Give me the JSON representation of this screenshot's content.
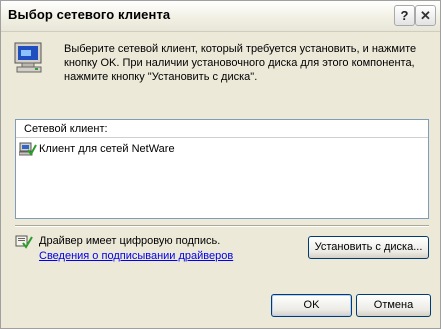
{
  "window": {
    "title": "Выбор сетевого клиента",
    "help_glyph": "?",
    "close_glyph": "✕"
  },
  "instructions": "Выберите сетевой клиент, который требуется установить, и нажмите кнопку OK. При наличии установочного диска для этого компонента, нажмите кнопку \"Установить с диска\".",
  "list": {
    "header": "Сетевой клиент:",
    "items": [
      {
        "label": "Клиент для сетей NetWare",
        "icon": "network-client-icon"
      }
    ]
  },
  "signature": {
    "text": "Драйвер имеет цифровую подпись.",
    "link": "Сведения о подписывании драйверов",
    "icon": "signed-driver-icon"
  },
  "buttons": {
    "install": "Установить с диска...",
    "ok": "OK",
    "cancel": "Отмена"
  },
  "colors": {
    "dialog_bg": "#ece9d8",
    "link": "#0000ee",
    "close_red": "#c0392b"
  }
}
